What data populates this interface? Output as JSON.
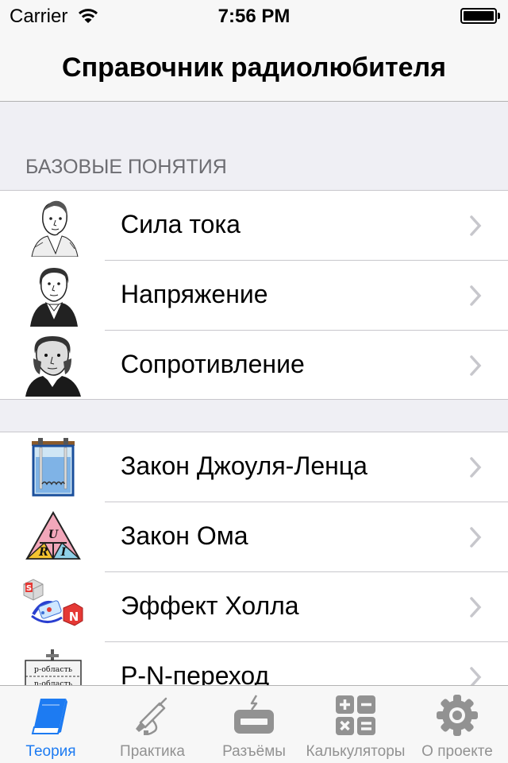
{
  "status_bar": {
    "carrier": "Carrier",
    "time": "7:56 PM"
  },
  "nav": {
    "title": "Справочник радиолюбителя"
  },
  "sections": [
    {
      "header": "БАЗОВЫЕ ПОНЯТИЯ",
      "items": [
        {
          "label": "Сила тока",
          "icon": "ampere-portrait-icon"
        },
        {
          "label": "Напряжение",
          "icon": "volta-portrait-icon"
        },
        {
          "label": "Сопротивление",
          "icon": "ohm-portrait-icon"
        }
      ]
    },
    {
      "header": "",
      "items": [
        {
          "label": "Закон Джоуля-Ленца",
          "icon": "calorimeter-icon"
        },
        {
          "label": "Закон Ома",
          "icon": "ohm-triangle-icon"
        },
        {
          "label": "Эффект Холла",
          "icon": "hall-effect-icon"
        },
        {
          "label": "P-N-переход",
          "icon": "pn-junction-icon"
        }
      ]
    }
  ],
  "icon_text": {
    "ohm_triangle": [
      "U",
      "R",
      "I"
    ],
    "hall_letters": [
      "S",
      "N"
    ],
    "pn_layers": [
      "p-область",
      "n-область"
    ]
  },
  "tabs": [
    {
      "label": "Теория",
      "icon": "book-icon",
      "active": true
    },
    {
      "label": "Практика",
      "icon": "soldering-iron-icon",
      "active": false
    },
    {
      "label": "Разъёмы",
      "icon": "connector-icon",
      "active": false
    },
    {
      "label": "Калькуляторы",
      "icon": "calculator-icon",
      "active": false
    },
    {
      "label": "О проекте",
      "icon": "gear-icon",
      "active": false
    }
  ],
  "colors": {
    "accent": "#1d7bf2",
    "tab_inactive": "#929292",
    "background": "#efeff4",
    "section_header": "#6d6d72",
    "chevron": "#c7c7cc"
  }
}
